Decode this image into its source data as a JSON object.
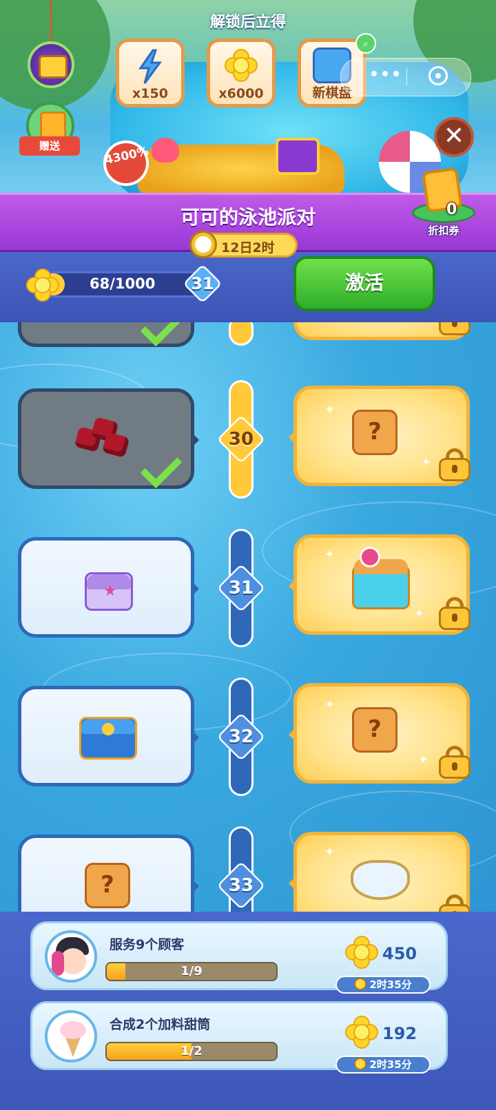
{
  "banner": {
    "unlock_title": "解锁后立得",
    "rewards": [
      {
        "icon": "energy-bolt-icon",
        "qty": "x150"
      },
      {
        "icon": "flower-coin-icon",
        "qty": "x6000"
      },
      {
        "icon": "game-board-icon",
        "qty": "新棋盘"
      }
    ],
    "gift_label": "赠送",
    "discount_badge": "4300%",
    "coupon": {
      "count": "0",
      "label": "折扣券"
    },
    "capsule_dots": "•••"
  },
  "event": {
    "title": "可可的泳池派对",
    "timer": "12日2时",
    "progress": {
      "current": 68,
      "max": 1000,
      "label": "68/1000",
      "fraction": 0.068
    },
    "level": "31",
    "activate_label": "激活"
  },
  "track": {
    "rows": [
      {
        "level": "30",
        "free_item": "ruby-gems",
        "free_claimed": true,
        "premium_item": "mystery-box",
        "premium_locked": true
      },
      {
        "level": "31",
        "free_item": "purple-chest",
        "free_claimed": false,
        "premium_item": "treasure-chest",
        "premium_locked": true
      },
      {
        "level": "32",
        "free_item": "blue-chest",
        "free_claimed": false,
        "premium_item": "mystery-box",
        "premium_locked": true
      },
      {
        "level": "33",
        "free_item": "mystery-box",
        "free_claimed": false,
        "premium_item": "flower-bowl",
        "premium_locked": true
      }
    ]
  },
  "tasks": [
    {
      "name": "服务9个顾客",
      "progress_label": "1/9",
      "progress_fraction": 0.111,
      "reward": "450",
      "timer": "2时35分",
      "avatar": "character-avatar"
    },
    {
      "name": "合成2个加料甜筒",
      "progress_label": "1/2",
      "progress_fraction": 0.5,
      "reward": "192",
      "timer": "2时35分",
      "avatar": "ice-cream-avatar"
    }
  ],
  "colors": {
    "premium_gold": "#ffc93a",
    "free_blue": "#2f68b8",
    "activate_green": "#2fae2a",
    "event_purple": "#9a38d6"
  }
}
